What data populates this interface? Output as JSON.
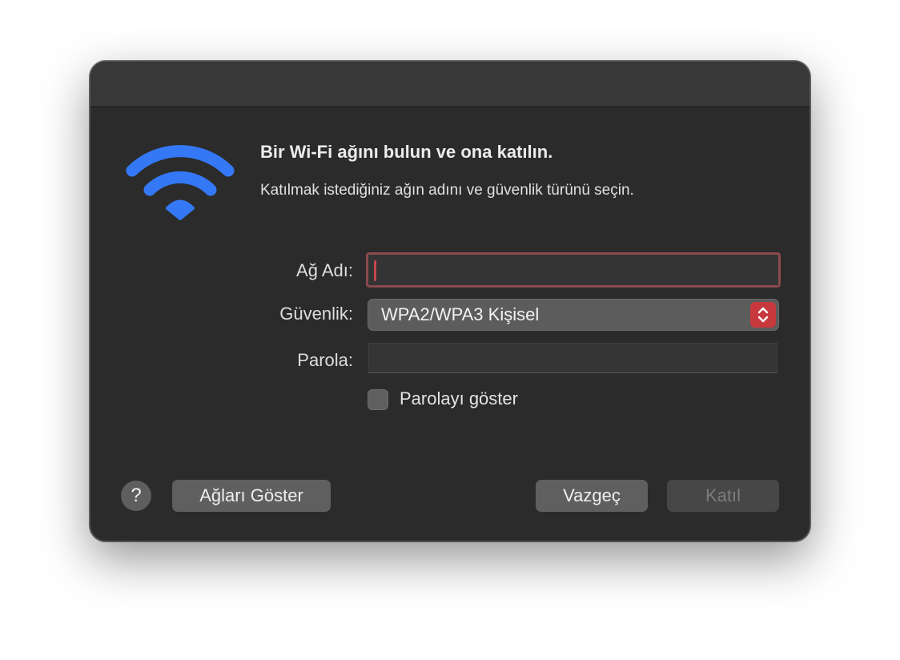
{
  "dialog": {
    "icon": "wifi-icon",
    "title": "Bir Wi-Fi ağını bulun ve ona katılın.",
    "subtitle": "Katılmak istediğiniz ağın adını ve güvenlik türünü seçin."
  },
  "form": {
    "network_name_label": "Ağ Adı:",
    "network_name_value": "",
    "security_label": "Güvenlik:",
    "security_value": "WPA2/WPA3 Kişisel",
    "password_label": "Parola:",
    "password_value": "",
    "show_password_label": "Parolayı göster",
    "show_password_checked": false
  },
  "buttons": {
    "help_label": "?",
    "show_networks_label": "Ağları Göster",
    "cancel_label": "Vazgeç",
    "join_label": "Katıl",
    "join_enabled": false
  },
  "colors": {
    "accent": "#c8393e",
    "wifi_blue": "#3478f6"
  }
}
